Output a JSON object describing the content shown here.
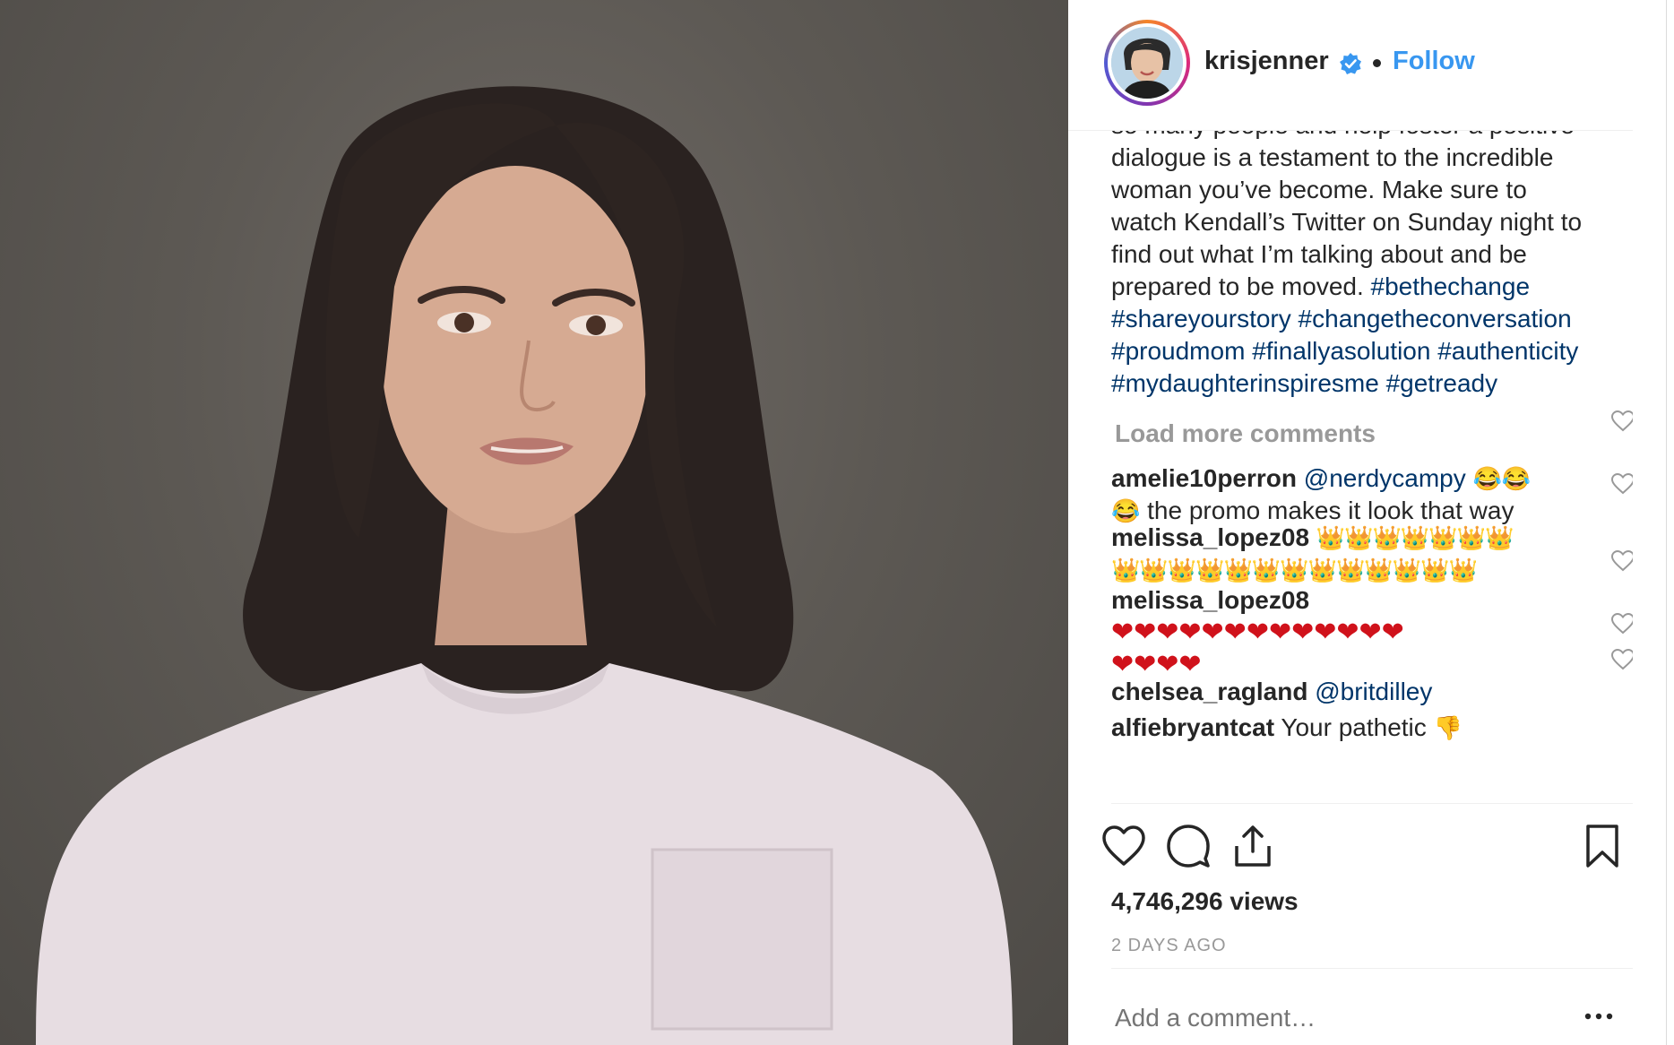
{
  "header": {
    "username": "krisjenner",
    "follow_label": "Follow"
  },
  "caption": {
    "lines": [
      "so many people and help foster a positive",
      "dialogue is a testament to the incredible",
      "woman you’ve become. Make sure to",
      "watch Kendall’s Twitter on Sunday night to",
      "find out what I’m talking about and be"
    ],
    "line6_text": "prepared to be moved. ",
    "hashtags": [
      "#bethechange",
      "#shareyourstory",
      "#changetheconversation",
      "#proudmom",
      "#finallyasolution",
      "#authenticity",
      "#mydaughterinspiresme",
      "#getready"
    ]
  },
  "load_more_label": "Load more comments",
  "comments": [
    {
      "user": "amelie10perron",
      "mention": "@nerdycampy",
      "text": " the promo makes it look that way",
      "emoji": "😂😂😂"
    },
    {
      "user": "melissa_lopez08",
      "text": "",
      "emoji": "👑 x 20"
    },
    {
      "user": "melissa_lopez08",
      "text": "",
      "emoji": "❤️ x 17"
    },
    {
      "user": "chelsea_ragland",
      "mention": "@britdilley",
      "text": ""
    },
    {
      "user": "alfiebryantcat",
      "text": "Your pathetic",
      "emoji": "👎"
    }
  ],
  "stats": {
    "views": "4,746,296 views",
    "time_ago": "2 DAYS AGO"
  },
  "add_comment": {
    "placeholder": "Add a comment…"
  },
  "colors": {
    "link": "#3897f0",
    "hashtag": "#003569",
    "muted": "#999999"
  },
  "icons": [
    "verified-badge-icon",
    "heart-icon",
    "comment-icon",
    "share-icon",
    "bookmark-icon",
    "more-options-icon"
  ]
}
